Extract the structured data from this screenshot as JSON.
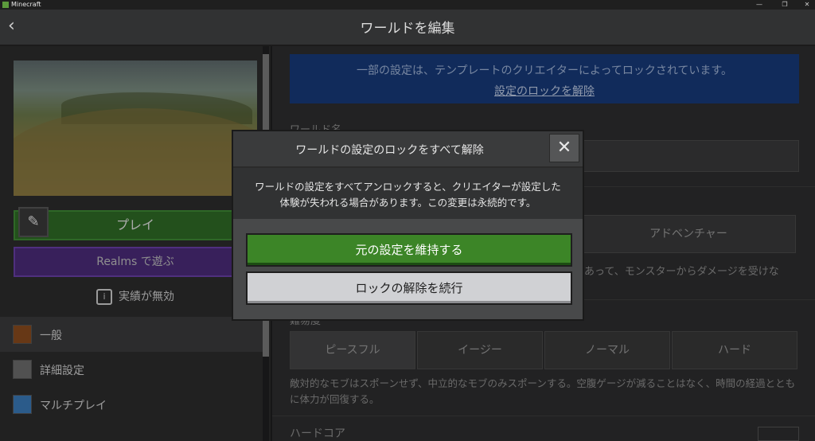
{
  "window": {
    "title": "Minecraft",
    "minimize": "—",
    "maximize": "❐",
    "close": "✕"
  },
  "header": {
    "back_icon": "‹",
    "title": "ワールドを編集"
  },
  "left": {
    "edit_icon": "✎",
    "play_label": "プレイ",
    "realms_label": "Realms で遊ぶ",
    "achievements_label": "実績が無効",
    "info_icon": "i",
    "nav": [
      {
        "label": "一般"
      },
      {
        "label": "詳細設定"
      },
      {
        "label": "マルチプレイ"
      }
    ]
  },
  "right": {
    "banner_text": "一部の設定は、テンプレートのクリエイターによってロックされています。",
    "banner_link": "設定のロックを解除",
    "world_name_label": "ワールド名",
    "mode_adventure": "アドベンチャー",
    "mode_desc": "あって、モンスターからダメージを受けな",
    "difficulty_label": "難易度",
    "difficulty": [
      "ピースフル",
      "イージー",
      "ノーマル",
      "ハード"
    ],
    "difficulty_desc": "敵対的なモブはスポーンせず、中立的なモブのみスポーンする。空腹ゲージが減ることはなく、時間の経過とともに体力が回復する。",
    "hardcore_label": "ハードコア"
  },
  "modal": {
    "title": "ワールドの設定のロックをすべて解除",
    "close_icon": "✕",
    "body_line1": "ワールドの設定をすべてアンロックすると、クリエイターが設定した",
    "body_line2": "体験が失われる場合があります。この変更は永続的です。",
    "keep_button": "元の設定を維持する",
    "unlock_button": "ロックの解除を続行"
  },
  "colors": {
    "accent_green": "#3c8527",
    "realms_purple": "#4b2b7a",
    "banner_blue": "#173a7a"
  }
}
